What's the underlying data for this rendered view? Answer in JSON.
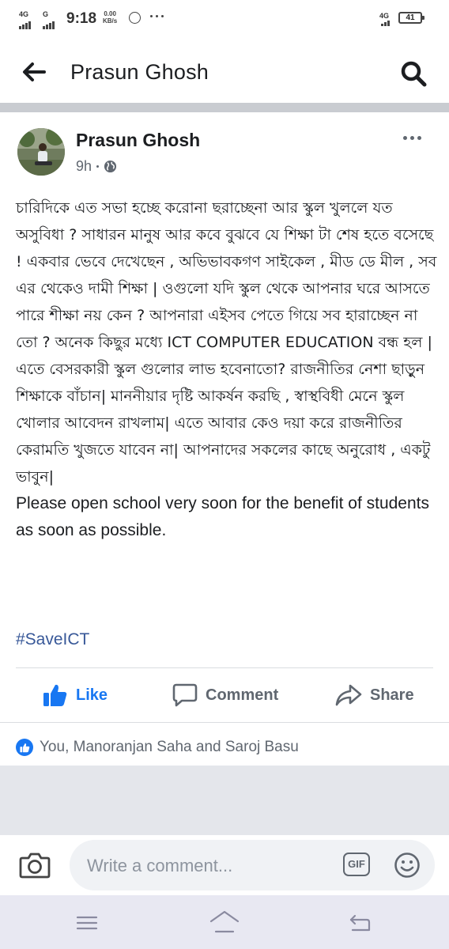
{
  "status_bar": {
    "network_1": "4G",
    "network_2": "G",
    "time": "9:18",
    "speed_value": "0.00",
    "speed_unit": "KB/s",
    "network_right": "4G",
    "battery": "41"
  },
  "header": {
    "title": "Prasun Ghosh"
  },
  "post": {
    "author": "Prasun Ghosh",
    "time": "9h",
    "body_bn": "চারিদিকে এত সভা হচ্ছে করোনা ছরাচ্ছেনা আর স্কুল খুললে যত অসুবিধা ? সাধারন মানুষ আর কবে বুঝবে যে শিক্ষা টা শেষ হতে বসেছে ! একবার ভেবে দেখেছেন , অভিভাবকগণ সাইকেল , মীড ডে মীল , সব এর থেকেও দামী শিক্ষা | ওগুলো যদি স্কুল থেকে আপনার ঘরে আসতে পারে শীক্ষা নয় কেন ? আপনারা এইসব পেতে গিয়ে সব হারাচ্ছেন না তো ? অনেক কিছুর মধ্যে ICT COMPUTER EDUCATION বন্ধ হল | এতে বেসরকারী স্কুল গুলোর লাভ হবেনাতো? রাজনীতির নেশা ছাড়ুন শিক্ষাকে বাঁচান| মাননীয়ার দৃষ্টি আকর্ষন করছি , স্বাস্থবিধী মেনে স্কুল খোলার আবেদন রাখলাম|  এতে আবার কেও দয়া করে রাজনীতির কেরামতি খুজতে যাবেন না| আপনাদের সকলের কাছে অনুরোধ , একটু ভাবুন|",
    "body_en": "Please open school very soon for the benefit of students as soon as possible.",
    "hashtag": "#SaveICT"
  },
  "actions": {
    "like": "Like",
    "comment": "Comment",
    "share": "Share"
  },
  "reactions": {
    "text": "You, Manoranjan Saha and Saroj Basu"
  },
  "composer": {
    "placeholder": "Write a comment...",
    "gif_label": "GIF"
  },
  "colors": {
    "accent": "#1877f2",
    "hashtag": "#385898",
    "divider": "#c9ccd1",
    "nav_bar": "#e8e8f2"
  },
  "icons": {
    "back": "arrow-left-icon",
    "search": "search-icon",
    "more": "more-horizontal-icon",
    "privacy": "globe-icon",
    "like": "thumbs-up-icon",
    "comment": "comment-bubble-icon",
    "share": "share-arrow-icon",
    "camera": "camera-icon",
    "emoji": "smiley-icon"
  }
}
